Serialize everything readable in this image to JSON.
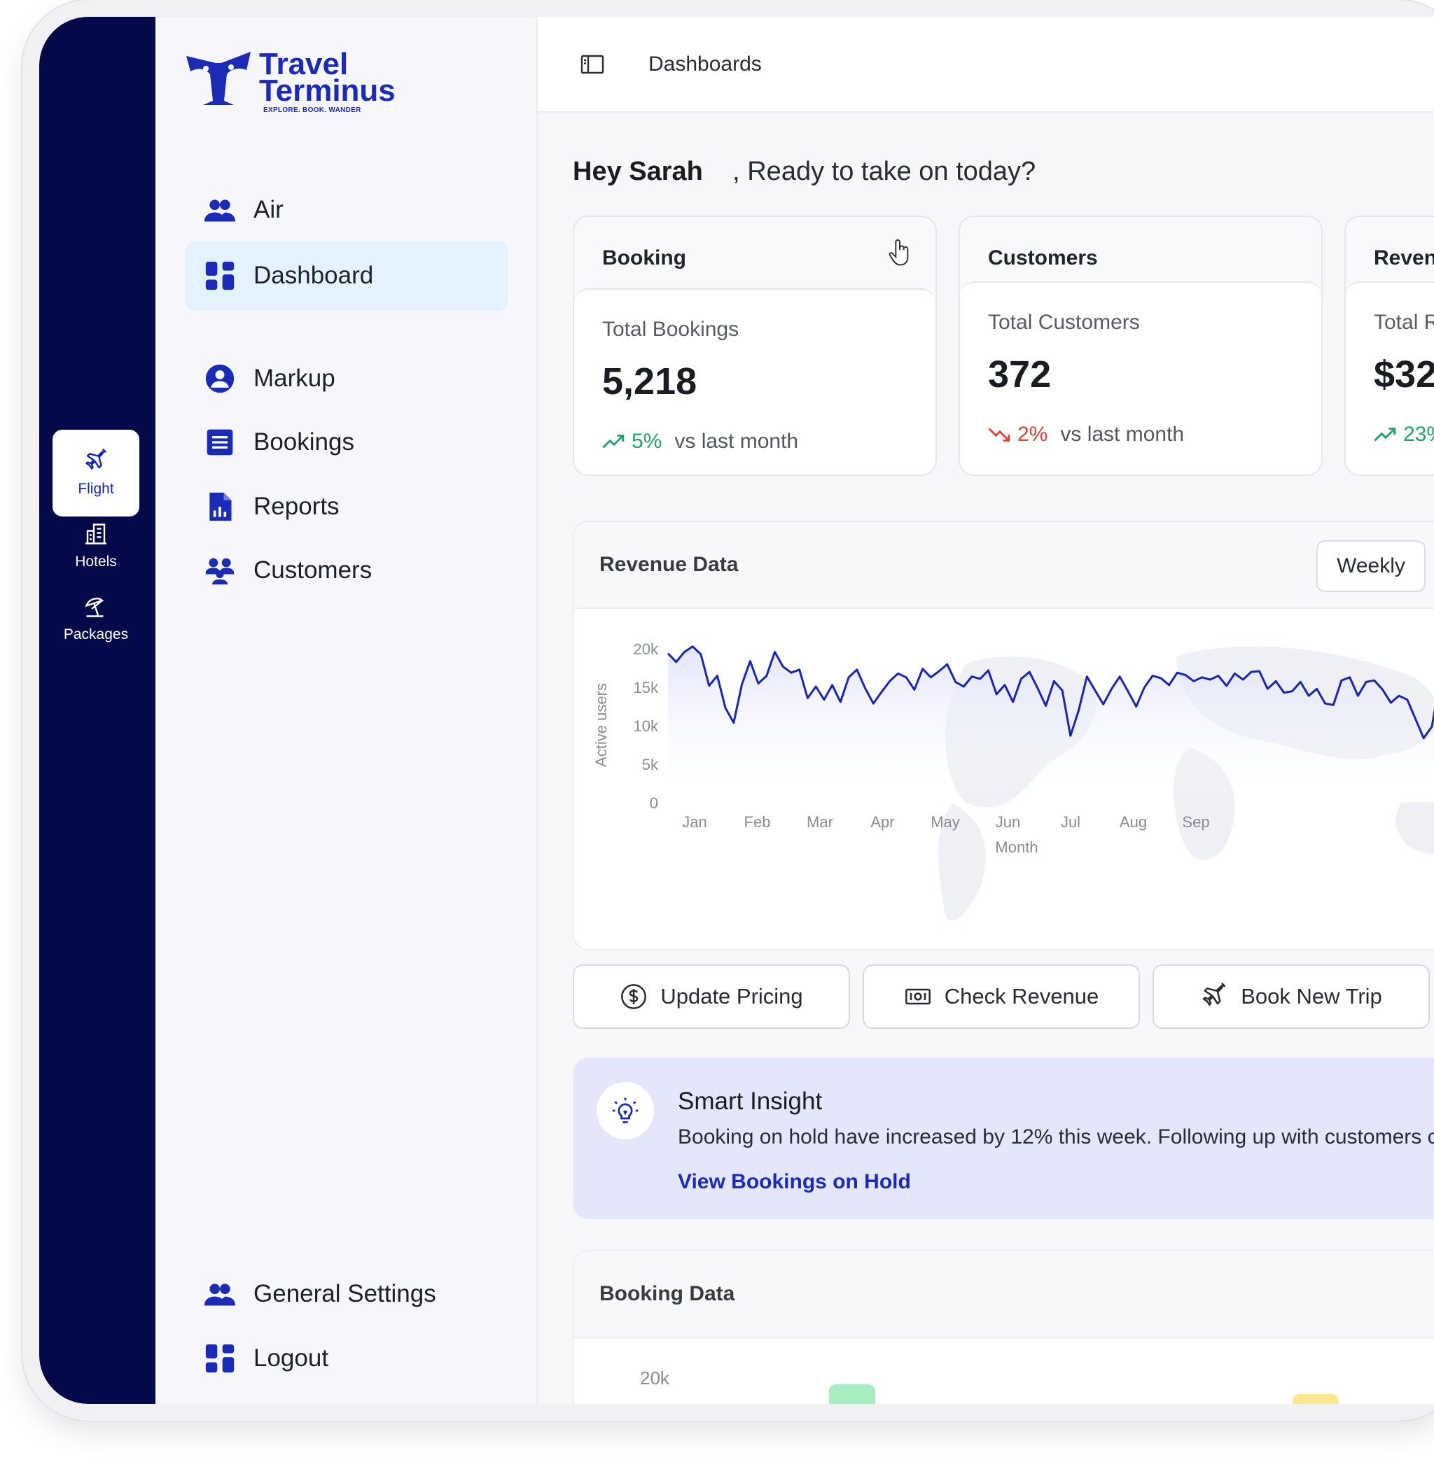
{
  "rail": {
    "items": [
      {
        "label": "Flight",
        "icon": "plane-icon"
      },
      {
        "label": "Hotels",
        "icon": "building-icon"
      },
      {
        "label": "Packages",
        "icon": "beach-umbrella-icon"
      }
    ]
  },
  "logo": {
    "line1": "Travel",
    "line2": "Terminus",
    "tagline": "EXPLORE. BOOK. WANDER"
  },
  "sidebar": {
    "items": [
      {
        "label": "Air",
        "icon": "users-icon"
      },
      {
        "label": "Dashboard",
        "icon": "grid-icon"
      },
      {
        "label": "Markup",
        "icon": "user-circle-icon"
      },
      {
        "label": "Bookings",
        "icon": "list-icon"
      },
      {
        "label": "Reports",
        "icon": "report-file-icon"
      },
      {
        "label": "Customers",
        "icon": "group-icon"
      }
    ],
    "bottom": [
      {
        "label": "General Settings",
        "icon": "users-icon"
      },
      {
        "label": "Logout",
        "icon": "grid-icon"
      }
    ]
  },
  "topbar": {
    "breadcrumb": "Dashboards"
  },
  "greeting": {
    "name": "Hey Sarah",
    "rest": ", Ready to take on today?"
  },
  "stats": [
    {
      "header": "Booking",
      "label": "Total Bookings",
      "value": "5,218",
      "trend": "up",
      "pct": "5%",
      "compare": "vs last month"
    },
    {
      "header": "Customers",
      "label": "Total Customers",
      "value": "372",
      "trend": "down",
      "pct": "2%",
      "compare": "vs last month"
    },
    {
      "header": "Revenu",
      "label": "Total R",
      "value": "$32",
      "trend": "up",
      "pct": "23%",
      "compare": ""
    }
  ],
  "revenue_card": {
    "title": "Revenue Data",
    "period": "Weekly"
  },
  "chart_data": {
    "type": "line",
    "title": "Revenue Data",
    "xlabel": "Month",
    "ylabel": "Active users",
    "ylim": [
      0,
      20000
    ],
    "yticks": [
      "0",
      "5k",
      "10k",
      "15k",
      "20k"
    ],
    "xticks": [
      "Jan",
      "Feb",
      "Mar",
      "Apr",
      "May",
      "Jun",
      "Jul",
      "Aug",
      "Sep"
    ],
    "color": "#1a25b0",
    "series": [
      {
        "values": [
          19300,
          18200,
          19500,
          20200,
          19200,
          15100,
          16400,
          12200,
          10300,
          15300,
          18300,
          15400,
          16400,
          19500,
          17600,
          16800,
          17200,
          13500,
          15000,
          13300,
          15200,
          13000,
          16200,
          17200,
          14800,
          12800,
          14300,
          15700,
          16700,
          16200,
          14600,
          17300,
          16200,
          17000,
          17900,
          15600,
          15000,
          16300,
          16000,
          17100,
          14000,
          15200,
          13000,
          16000,
          16900,
          14800,
          12500,
          15700,
          14500,
          8600,
          11900,
          16300,
          14500,
          12700,
          14700,
          16300,
          14400,
          12400,
          14900,
          16400,
          16100,
          15200,
          16800,
          16500,
          15700,
          16200,
          15900,
          16400,
          15100,
          16700,
          15900,
          16900,
          17000,
          14700,
          15700,
          14200,
          14400,
          15600,
          13800,
          14700,
          12800,
          12600,
          15800,
          16200,
          13800,
          15600,
          15800,
          14600,
          12900,
          13800,
          13300,
          10800,
          8300,
          9800,
          16000,
          13600,
          15700,
          14000,
          12000,
          12000,
          13800,
          11800,
          12700,
          11000,
          13400
        ]
      }
    ],
    "grid": false,
    "background": "world-map"
  },
  "actions": [
    {
      "label": "Update Pricing",
      "icon": "dollar-circle-icon"
    },
    {
      "label": "Check Revenue",
      "icon": "cash-icon"
    },
    {
      "label": "Book New Trip",
      "icon": "plane-icon"
    }
  ],
  "insight": {
    "title": "Smart Insight",
    "text": "Booking on hold have increased by 12% this week. Following up with customers c",
    "link": "View Bookings on Hold"
  },
  "booking_card": {
    "title": "Booking Data",
    "tick": "20k"
  },
  "colors": {
    "brand": "#1a2bb8",
    "rail": "#04094a",
    "active_bg": "#e3f2fd",
    "up": "#1ea464",
    "down": "#e0413b"
  }
}
